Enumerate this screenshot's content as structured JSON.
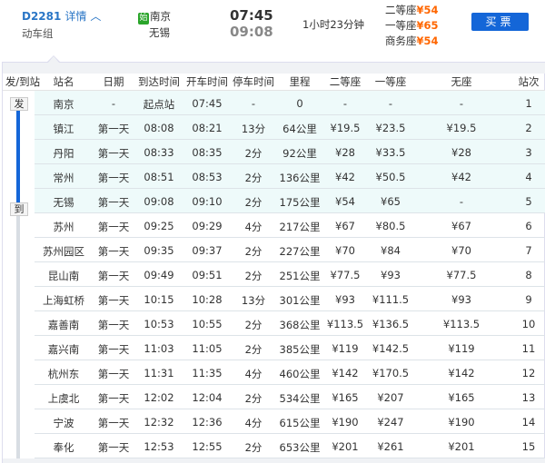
{
  "header": {
    "train_no": "D2281",
    "detail_label": "详情",
    "train_type": "动车组",
    "start_badge": "始",
    "from": "南京",
    "to": "无锡",
    "depart": "07:45",
    "arrive": "09:08",
    "duration": "1小时23分钟",
    "prices": [
      {
        "label": "二等座",
        "value": "¥54"
      },
      {
        "label": "一等座",
        "value": "¥65"
      },
      {
        "label": "商务座",
        "value": "¥54"
      }
    ],
    "buy_label": "买票"
  },
  "table": {
    "columns": [
      "发/到站",
      "站名",
      "日期",
      "到达时间",
      "开车时间",
      "停车时间",
      "里程",
      "二等座",
      "一等座",
      "无座",
      "站次"
    ],
    "depart_tag": "发",
    "arrive_tag": "到",
    "rows": [
      [
        "南京",
        "-",
        "起点站",
        "07:45",
        "-",
        "0",
        "-",
        "-",
        "-",
        "1"
      ],
      [
        "镇江",
        "第一天",
        "08:08",
        "08:21",
        "13分",
        "64公里",
        "¥19.5",
        "¥23.5",
        "¥19.5",
        "2"
      ],
      [
        "丹阳",
        "第一天",
        "08:33",
        "08:35",
        "2分",
        "92公里",
        "¥28",
        "¥33.5",
        "¥28",
        "3"
      ],
      [
        "常州",
        "第一天",
        "08:51",
        "08:53",
        "2分",
        "136公里",
        "¥42",
        "¥50.5",
        "¥42",
        "4"
      ],
      [
        "无锡",
        "第一天",
        "09:08",
        "09:10",
        "2分",
        "175公里",
        "¥54",
        "¥65",
        "-",
        "5"
      ],
      [
        "苏州",
        "第一天",
        "09:25",
        "09:29",
        "4分",
        "217公里",
        "¥67",
        "¥80.5",
        "¥67",
        "6"
      ],
      [
        "苏州园区",
        "第一天",
        "09:35",
        "09:37",
        "2分",
        "227公里",
        "¥70",
        "¥84",
        "¥70",
        "7"
      ],
      [
        "昆山南",
        "第一天",
        "09:49",
        "09:51",
        "2分",
        "251公里",
        "¥77.5",
        "¥93",
        "¥77.5",
        "8"
      ],
      [
        "上海虹桥",
        "第一天",
        "10:15",
        "10:28",
        "13分",
        "301公里",
        "¥93",
        "¥111.5",
        "¥93",
        "9"
      ],
      [
        "嘉善南",
        "第一天",
        "10:53",
        "10:55",
        "2分",
        "368公里",
        "¥113.5",
        "¥136.5",
        "¥113.5",
        "10"
      ],
      [
        "嘉兴南",
        "第一天",
        "11:03",
        "11:05",
        "2分",
        "385公里",
        "¥119",
        "¥142.5",
        "¥119",
        "11"
      ],
      [
        "杭州东",
        "第一天",
        "11:31",
        "11:35",
        "4分",
        "460公里",
        "¥142",
        "¥170.5",
        "¥142",
        "12"
      ],
      [
        "上虞北",
        "第一天",
        "12:02",
        "12:04",
        "2分",
        "534公里",
        "¥165",
        "¥207",
        "¥165",
        "13"
      ],
      [
        "宁波",
        "第一天",
        "12:32",
        "12:36",
        "4分",
        "615公里",
        "¥190",
        "¥247",
        "¥190",
        "14"
      ],
      [
        "奉化",
        "第一天",
        "12:53",
        "12:55",
        "2分",
        "653公里",
        "¥201",
        "¥261",
        "¥201",
        "15"
      ]
    ]
  },
  "colors": {
    "accent": "#1466d8",
    "price": "#ff6600",
    "highlight": "#eefafa"
  }
}
